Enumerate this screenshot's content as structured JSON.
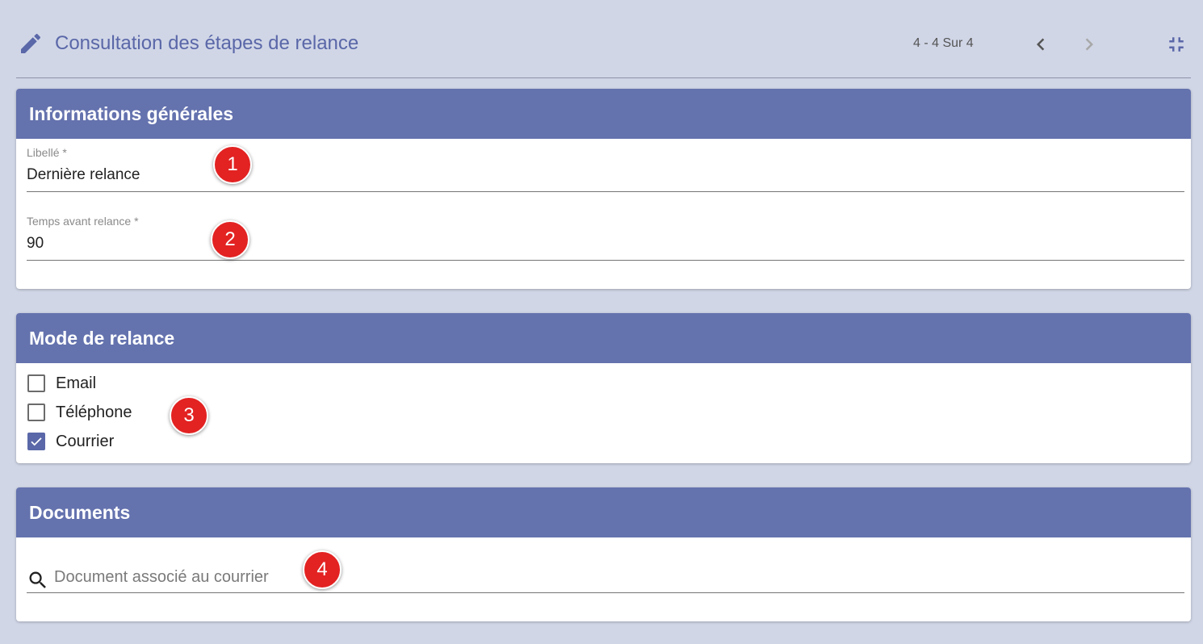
{
  "header": {
    "title": "Consultation des étapes de relance",
    "pager": "4 - 4 Sur 4",
    "icons": {
      "edit": "pencil-icon",
      "prev": "chevron-left-icon",
      "next": "chevron-right-icon",
      "collapse": "fullscreen-exit-icon"
    }
  },
  "general": {
    "title": "Informations générales",
    "fields": [
      {
        "label": "Libellé *",
        "value": "Dernière relance",
        "badge": "1"
      },
      {
        "label": "Temps avant relance *",
        "value": "90",
        "badge": "2"
      }
    ]
  },
  "mode": {
    "title": "Mode de relance",
    "options": [
      {
        "label": "Email",
        "checked": false
      },
      {
        "label": "Téléphone",
        "checked": false
      },
      {
        "label": "Courrier",
        "checked": true
      }
    ],
    "badge": "3"
  },
  "documents": {
    "title": "Documents",
    "search_placeholder": "Document associé au courrier",
    "badge": "4"
  },
  "colors": {
    "background": "#d0d6e6",
    "header_bar": "#6472ae",
    "accent": "#5a67a8",
    "badge": "#e32222"
  }
}
